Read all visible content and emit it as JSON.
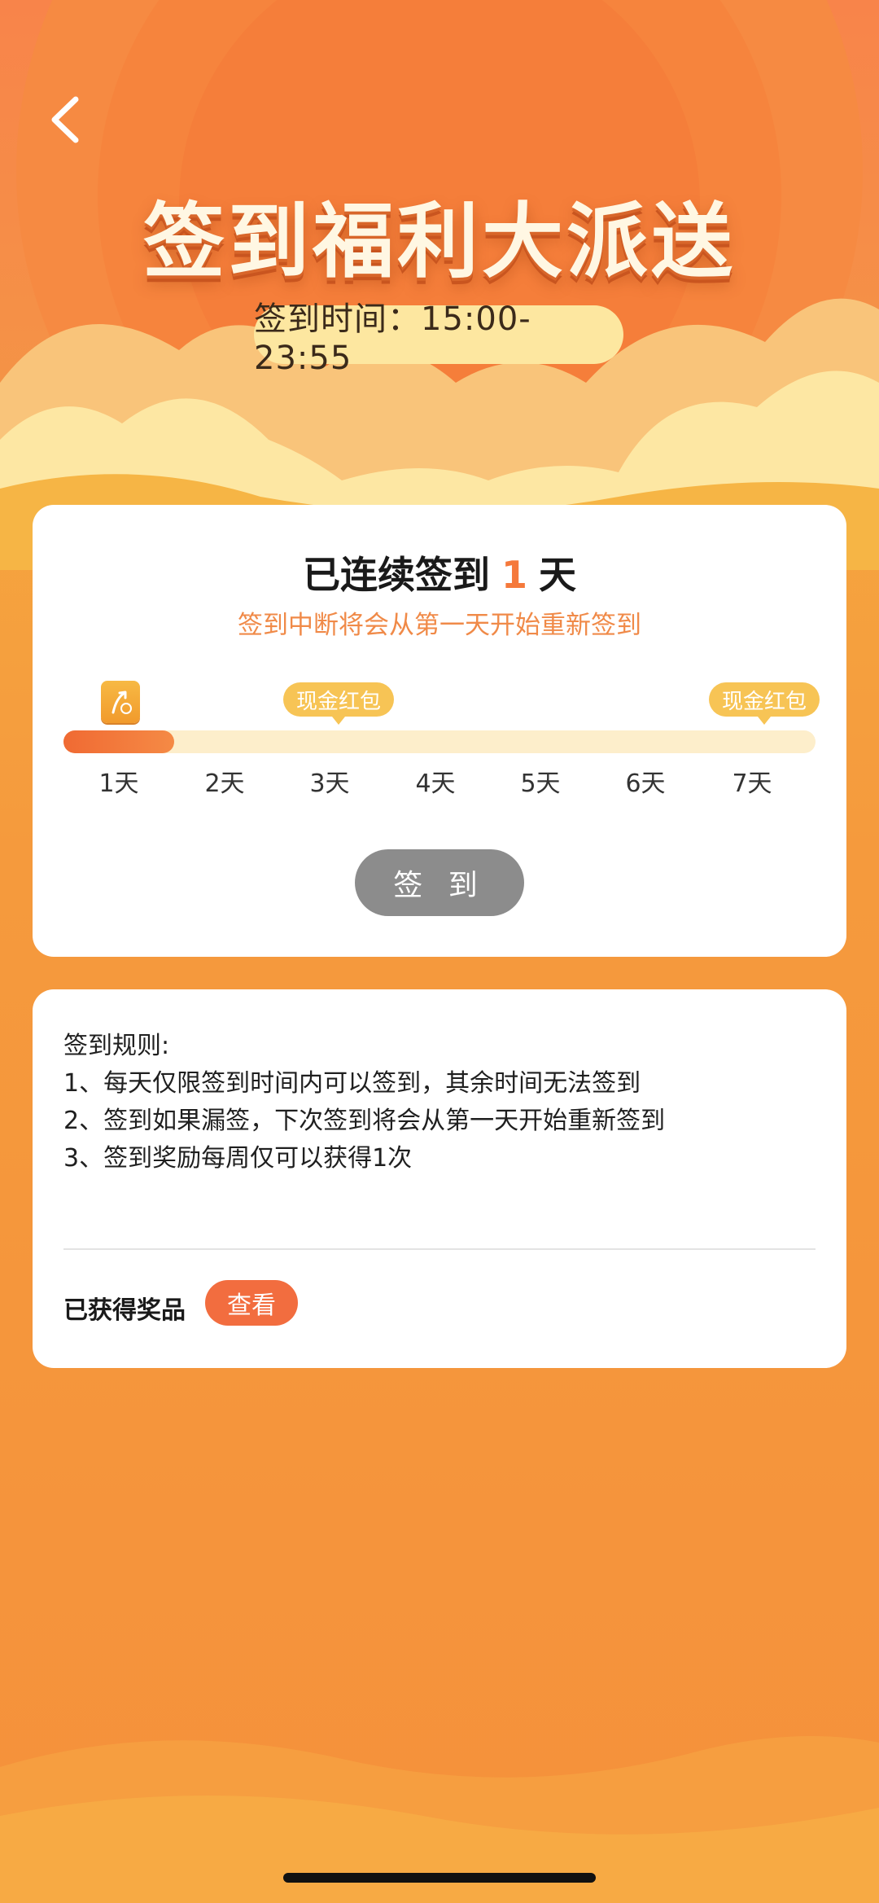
{
  "header": {
    "title": "签到福利大派送",
    "checkin_time": "签到时间：15:00-23:55"
  },
  "status": {
    "streak_prefix": "已连续签到",
    "streak_days": "1",
    "streak_suffix": "天",
    "reset_notice": "签到中断将会从第一天开始重新签到",
    "progress_days_completed": 1,
    "progress_days_total": 7
  },
  "days": [
    "1天",
    "2天",
    "3天",
    "4天",
    "5天",
    "6天",
    "7天"
  ],
  "milestones": {
    "day3": "现金红包",
    "day7": "现金红包"
  },
  "checkin_button": "签 到",
  "rules": {
    "title": "签到规则:",
    "items": [
      "1、每天仅限签到时间内可以签到，其余时间无法签到",
      "2、签到如果漏签，下次签到将会从第一天开始重新签到",
      "3、签到奖励每周仅可以获得1次"
    ]
  },
  "prizes": {
    "label": "已获得奖品",
    "view_button": "查看"
  },
  "icons": {
    "back": "chevron-left-icon",
    "reward": "coin-icon"
  },
  "colors": {
    "accent": "#f5793b",
    "background": "#f58a3d",
    "milestone": "#f7c455",
    "disabled_button": "#8c8c8c",
    "view_button": "#f26d3f"
  }
}
